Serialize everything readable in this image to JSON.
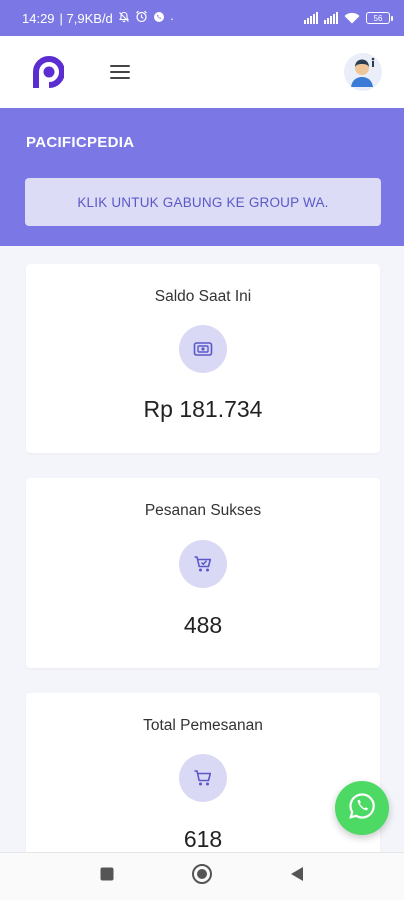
{
  "status_bar": {
    "time": "14:29",
    "network_speed": "| 7,9KB/d",
    "dot": "·",
    "battery": "56"
  },
  "header": {
    "logo_icon": "pacificpedia-logo-icon",
    "menu_icon": "hamburger-icon",
    "avatar_icon": "user-avatar-icon"
  },
  "hero": {
    "brand": "PACIFICPEDIA",
    "banner_text": "KLIK UNTUK GABUNG KE GROUP WA."
  },
  "cards": [
    {
      "title": "Saldo Saat Ini",
      "icon": "wallet-icon",
      "value": "Rp 181.734"
    },
    {
      "title": "Pesanan Sukses",
      "icon": "cart-check-icon",
      "value": "488"
    },
    {
      "title": "Total Pemesanan",
      "icon": "cart-icon",
      "value": "618"
    }
  ],
  "fab": {
    "icon": "whatsapp-icon"
  },
  "nav": {
    "icons": [
      "square-icon",
      "home-circle-icon",
      "back-triangle-icon"
    ]
  },
  "colors": {
    "accent": "#7b78e5",
    "banner_bg": "#dcdcf6",
    "banner_text": "#5b58c8",
    "icon_circle": "#d9d9f5",
    "whatsapp": "#4cd964"
  }
}
